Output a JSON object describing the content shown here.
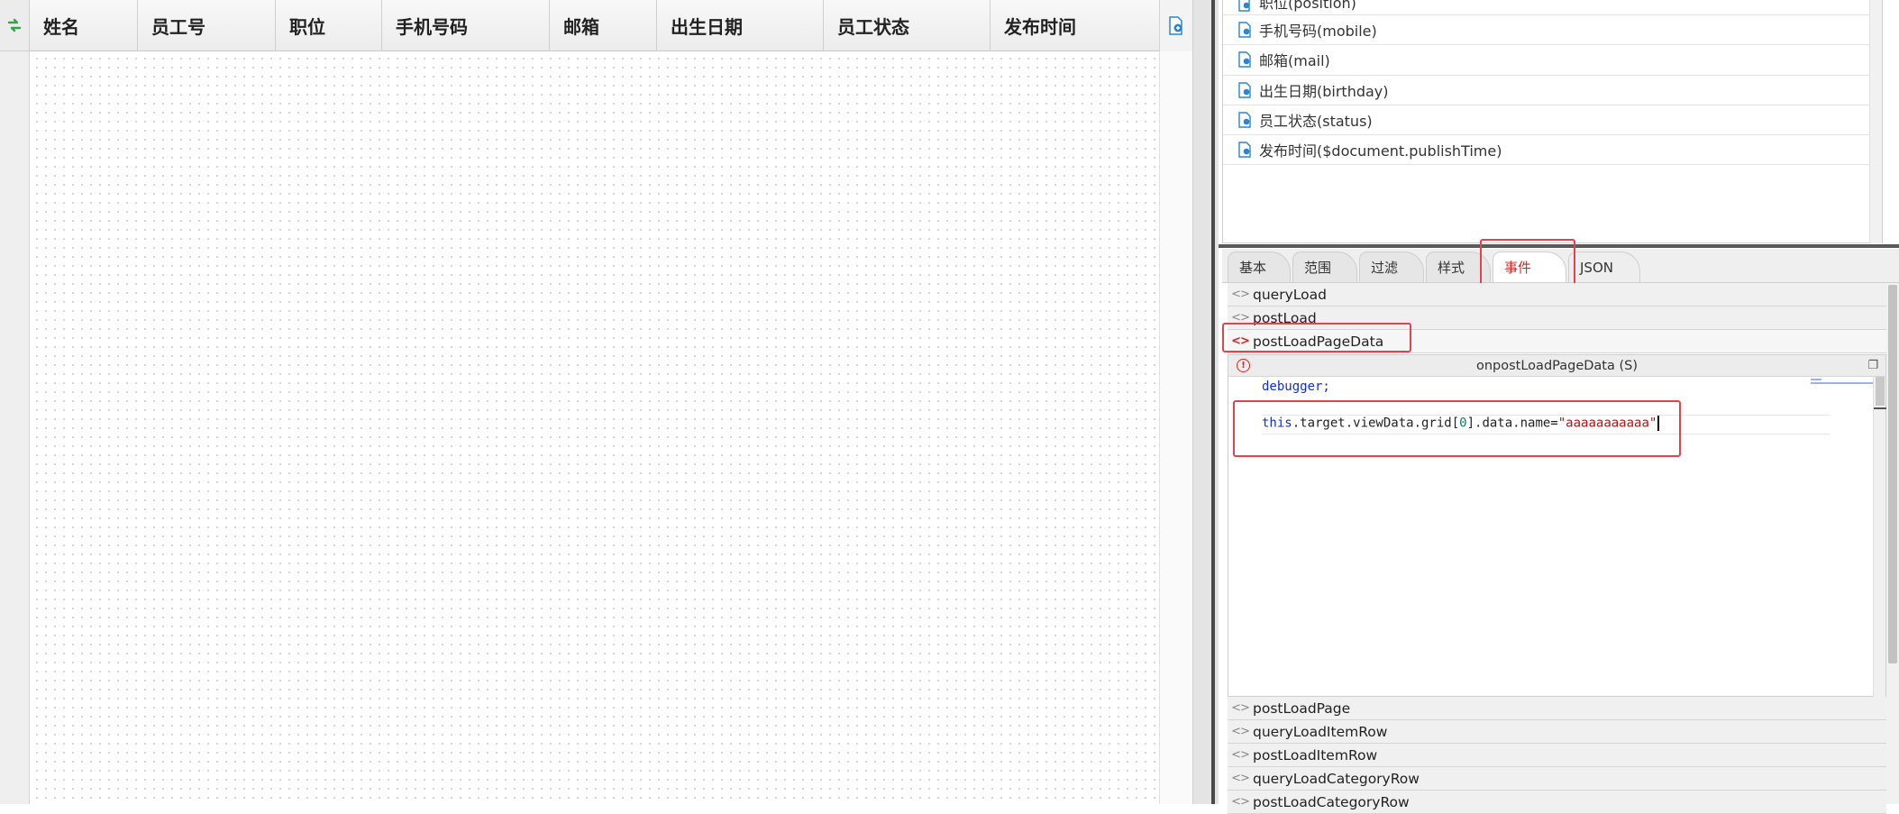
{
  "grid": {
    "columns": [
      "姓名",
      "员工号",
      "职位",
      "手机号码",
      "邮箱",
      "出生日期",
      "员工状态",
      "发布时间"
    ]
  },
  "fields": [
    {
      "label": "职位(position)"
    },
    {
      "label": "手机号码(mobile)"
    },
    {
      "label": "邮箱(mail)"
    },
    {
      "label": "出生日期(birthday)"
    },
    {
      "label": "员工状态(status)"
    },
    {
      "label": "发布时间($document.publishTime)"
    }
  ],
  "tabs": [
    {
      "label": "基本"
    },
    {
      "label": "范围"
    },
    {
      "label": "过滤"
    },
    {
      "label": "样式"
    },
    {
      "label": "事件",
      "active": true
    },
    {
      "label": "JSON"
    }
  ],
  "events": {
    "before": [
      "queryLoad",
      "postLoad"
    ],
    "open": "postLoadPageData",
    "after": [
      "postLoadPage",
      "queryLoadItemRow",
      "postLoadItemRow",
      "queryLoadCategoryRow",
      "postLoadCategoryRow"
    ]
  },
  "editor": {
    "title": "onpostLoadPageData (S)",
    "line1": "debugger;",
    "line2_kw": "this",
    "line2_a": ".target.viewData.grid[",
    "line2_num": "0",
    "line2_b": "].data.name=",
    "line2_str": "\"aaaaaaaaaaa\""
  },
  "colors": {
    "highlight": "#e3434d",
    "active_tab_text": "#c72b2b",
    "keyword": "#1030d0",
    "string": "#b01515"
  }
}
